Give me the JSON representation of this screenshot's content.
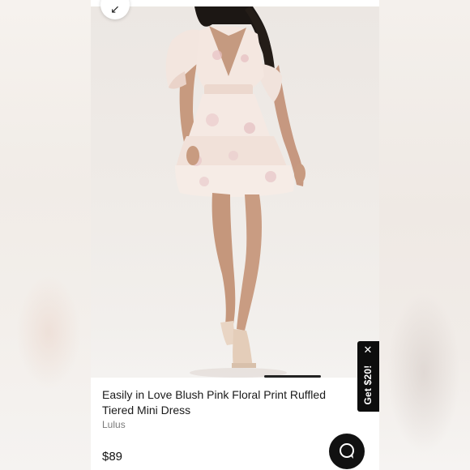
{
  "navigation": {
    "back_icon": "arrow-down-left-icon",
    "back_glyph": "↙"
  },
  "product": {
    "title": "Easily in Love Blush Pink Floral Print Ruffled Tiered Mini Dress",
    "brand": "Lulus",
    "price": "$89"
  },
  "promo": {
    "label": "Get $20!",
    "close_glyph": "✕"
  },
  "chat": {
    "icon": "chat-bubble-icon"
  },
  "colors": {
    "text_primary": "#1a1a1a",
    "text_secondary": "#7a7a7a",
    "promo_background": "#0d0d0d",
    "chat_background": "#111111"
  }
}
